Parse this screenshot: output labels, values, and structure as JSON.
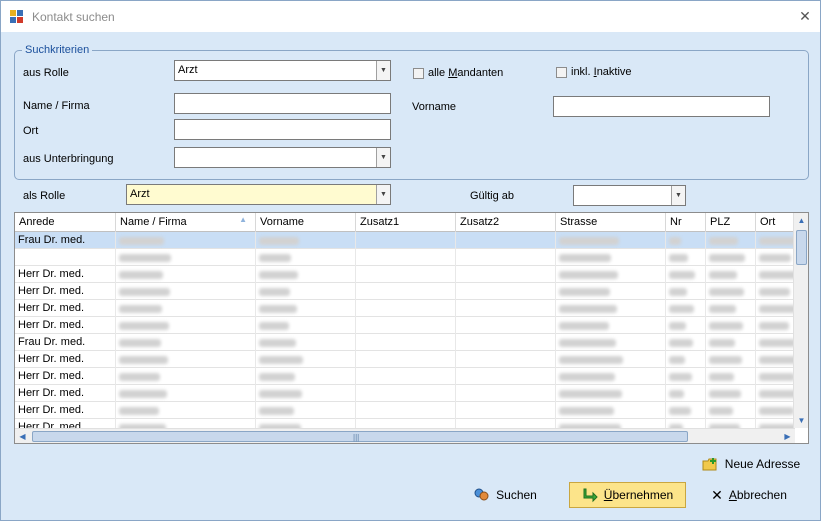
{
  "window": {
    "title": "Kontakt suchen"
  },
  "criteria": {
    "group_title": "Suchkriterien",
    "rolle_label": "aus Rolle",
    "rolle_value": "Arzt",
    "alle_mandanten_prefix": "alle ",
    "alle_mandanten_hotkey": "M",
    "alle_mandanten_suffix": "andanten",
    "inkl_inaktive_prefix": "inkl. ",
    "inkl_inaktive_hotkey": "I",
    "inkl_inaktive_suffix": "naktive",
    "name_label": "Name / Firma",
    "vorname_label": "Vorname",
    "ort_label": "Ort",
    "unterbringung_label": "aus Unterbringung"
  },
  "filter": {
    "als_rolle_label": "als Rolle",
    "als_rolle_value": "Arzt",
    "gueltig_label": "Gültig ab"
  },
  "grid": {
    "columns": [
      "Anrede",
      "Name / Firma",
      "Vorname",
      "Zusatz1",
      "Zusatz2",
      "Strasse",
      "Nr",
      "PLZ",
      "Ort"
    ],
    "rows": [
      {
        "anrede": "Frau Dr. med."
      },
      {
        "anrede": ""
      },
      {
        "anrede": "Herr Dr. med."
      },
      {
        "anrede": "Herr Dr. med."
      },
      {
        "anrede": "Herr Dr. med."
      },
      {
        "anrede": "Herr Dr. med."
      },
      {
        "anrede": "Frau Dr. med."
      },
      {
        "anrede": "Herr Dr. med."
      },
      {
        "anrede": "Herr Dr. med."
      },
      {
        "anrede": "Herr Dr. med."
      },
      {
        "anrede": "Herr Dr. med."
      },
      {
        "anrede": "Herr Dr. med."
      }
    ]
  },
  "actions": {
    "neue_adresse": "Neue Adresse",
    "suchen": "Suchen",
    "uebernehmen_hotkey": "Ü",
    "uebernehmen_rest": "bernehmen",
    "abbrechen_hotkey": "A",
    "abbrechen_rest": "bbrechen"
  },
  "colors": {
    "accent": "#1a4f9c",
    "selection": "#c9def5",
    "primary_button": "#fce48a"
  }
}
